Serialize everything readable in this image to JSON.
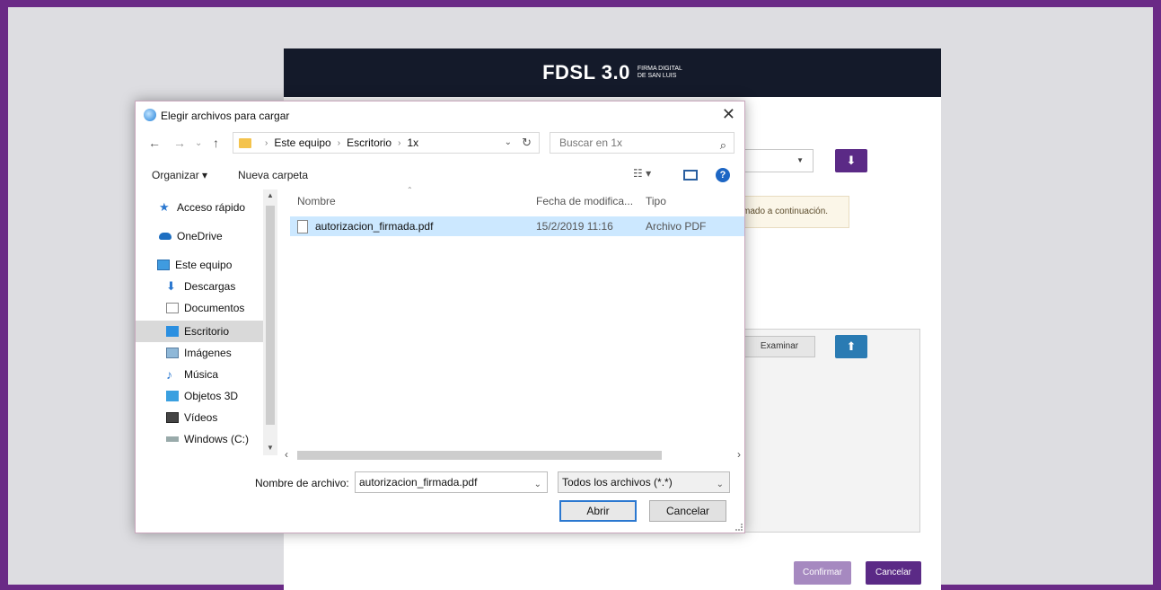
{
  "webpage": {
    "logo": "FDSL 3.0",
    "logo_sub_line1": "FIRMA DIGITAL",
    "logo_sub_line2": "DE SAN LUIS",
    "note_text": "mado a continuación.",
    "examine_label": "Examinar",
    "confirm_label": "Confirmar",
    "cancel_label": "Cancelar"
  },
  "dialog": {
    "title": "Elegir archivos para cargar",
    "breadcrumb": [
      "Este equipo",
      "Escritorio",
      "1x"
    ],
    "search_placeholder": "Buscar en 1x",
    "toolbar": {
      "organize_label": "Organizar ▾",
      "new_folder_label": "Nueva carpeta",
      "view_label": "☷ ▾"
    },
    "nav_items": [
      {
        "label": "Acceso rápido",
        "icon": "star-icon"
      },
      {
        "label": "OneDrive",
        "icon": "cloud-icon"
      },
      {
        "label": "Este equipo",
        "icon": "computer-icon"
      },
      {
        "label": "Descargas",
        "icon": "download-icon"
      },
      {
        "label": "Documentos",
        "icon": "document-icon"
      },
      {
        "label": "Escritorio",
        "icon": "desktop-icon"
      },
      {
        "label": "Imágenes",
        "icon": "image-icon"
      },
      {
        "label": "Música",
        "icon": "music-icon"
      },
      {
        "label": "Objetos 3D",
        "icon": "cube-icon"
      },
      {
        "label": "Vídeos",
        "icon": "video-icon"
      },
      {
        "label": "Windows (C:)",
        "icon": "drive-icon"
      }
    ],
    "columns": {
      "name": "Nombre",
      "date": "Fecha de modifica...",
      "type": "Tipo"
    },
    "files": [
      {
        "name": "autorizacion_firmada.pdf",
        "date": "15/2/2019 11:16",
        "type": "Archivo PDF"
      }
    ],
    "filename_label": "Nombre de archivo:",
    "filename_value": "autorizacion_firmada.pdf",
    "file_type": "Todos los archivos (*.*)",
    "open_label": "Abrir",
    "cancel_label": "Cancelar"
  }
}
